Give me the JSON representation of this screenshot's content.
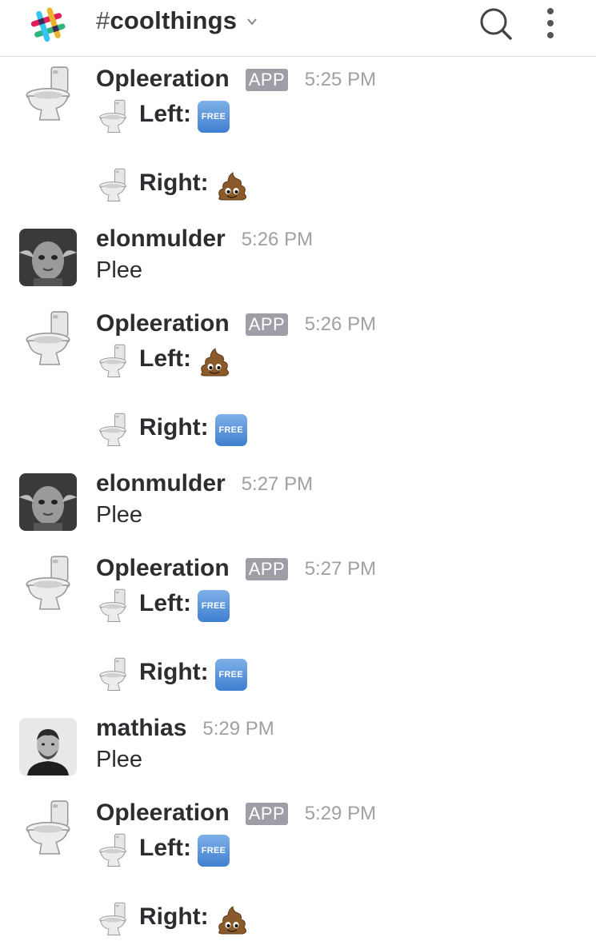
{
  "header": {
    "channel_hash": "#",
    "channel_name": "coolthings",
    "icons": [
      "slack-logo-icon",
      "chevron-down-icon",
      "search-icon",
      "more-vertical-icon"
    ]
  },
  "messages": [
    {
      "type": "bot",
      "name": "Opleeration",
      "badge": "APP",
      "time": "5:25 PM",
      "left_label": "Left:",
      "left_status": "FREE",
      "right_label": "Right:",
      "right_status": "poop"
    },
    {
      "type": "user",
      "name": "elonmulder",
      "time": "5:26 PM",
      "text": "Plee"
    },
    {
      "type": "bot",
      "name": "Opleeration",
      "badge": "APP",
      "time": "5:26 PM",
      "left_label": "Left:",
      "left_status": "poop",
      "right_label": "Right:",
      "right_status": "FREE"
    },
    {
      "type": "user",
      "name": "elonmulder",
      "time": "5:27 PM",
      "text": "Plee"
    },
    {
      "type": "bot",
      "name": "Opleeration",
      "badge": "APP",
      "time": "5:27 PM",
      "left_label": "Left:",
      "left_status": "FREE",
      "right_label": "Right:",
      "right_status": "FREE"
    },
    {
      "type": "user",
      "name": "mathias",
      "time": "5:29 PM",
      "text": "Plee"
    },
    {
      "type": "bot",
      "name": "Opleeration",
      "badge": "APP",
      "time": "5:29 PM",
      "left_label": "Left:",
      "left_status": "FREE",
      "right_label": "Right:",
      "right_status": "poop"
    }
  ],
  "free_badge_text": "FREE",
  "colors": {
    "free_blue": "#3f7fcf",
    "app_badge": "#9e9ea6",
    "timestamp": "#a0a0a2"
  }
}
